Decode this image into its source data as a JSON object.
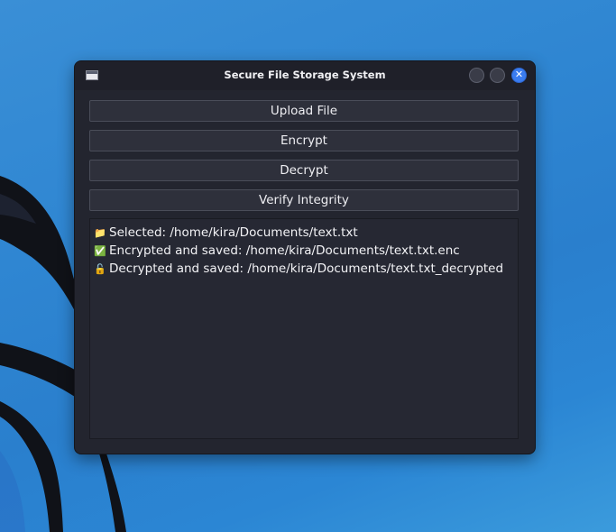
{
  "window": {
    "title": "Secure File Storage System",
    "controls": [
      "minimize",
      "maximize",
      "close"
    ]
  },
  "buttons": {
    "upload": "Upload File",
    "encrypt": "Encrypt",
    "decrypt": "Decrypt",
    "verify": "Verify Integrity"
  },
  "log": {
    "lines": [
      {
        "icon": "📁",
        "icon_name": "folder-icon",
        "text": "Selected: /home/kira/Documents/text.txt"
      },
      {
        "icon": "✅",
        "icon_name": "check-icon",
        "text": "Encrypted and saved: /home/kira/Documents/text.txt.enc"
      },
      {
        "icon": "🔓",
        "icon_name": "unlock-icon",
        "text": "Decrypted and saved: /home/kira/Documents/text.txt_decrypted"
      }
    ]
  },
  "colors": {
    "desktop": "#2f86d2",
    "window_bg": "#23252f",
    "button_bg": "#2e303b",
    "close_accent": "#3a7cf0"
  }
}
